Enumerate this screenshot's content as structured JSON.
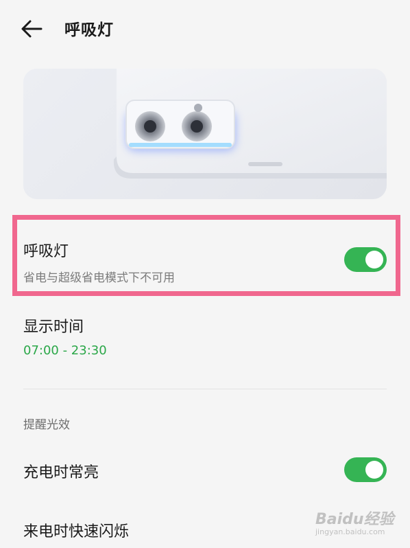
{
  "header": {
    "title": "呼吸灯",
    "back_icon": "back-arrow-icon"
  },
  "hero": {
    "description_icon": "phone-camera-illustration"
  },
  "breathing_light": {
    "title": "呼吸灯",
    "subtitle": "省电与超级省电模式下不可用",
    "enabled": true
  },
  "display_time": {
    "title": "显示时间",
    "value": "07:00 - 23:30"
  },
  "reminder_section": {
    "label": "提醒光效",
    "items": [
      {
        "label": "充电时常亮",
        "enabled": true
      },
      {
        "label": "来电时快速闪烁"
      }
    ]
  },
  "watermark": {
    "brand": "Baidu经验",
    "url": "jingyan.baidu.com"
  },
  "colors": {
    "accent_green": "#35b454",
    "highlight_pink": "#f0678e",
    "time_green": "#2aa748"
  }
}
